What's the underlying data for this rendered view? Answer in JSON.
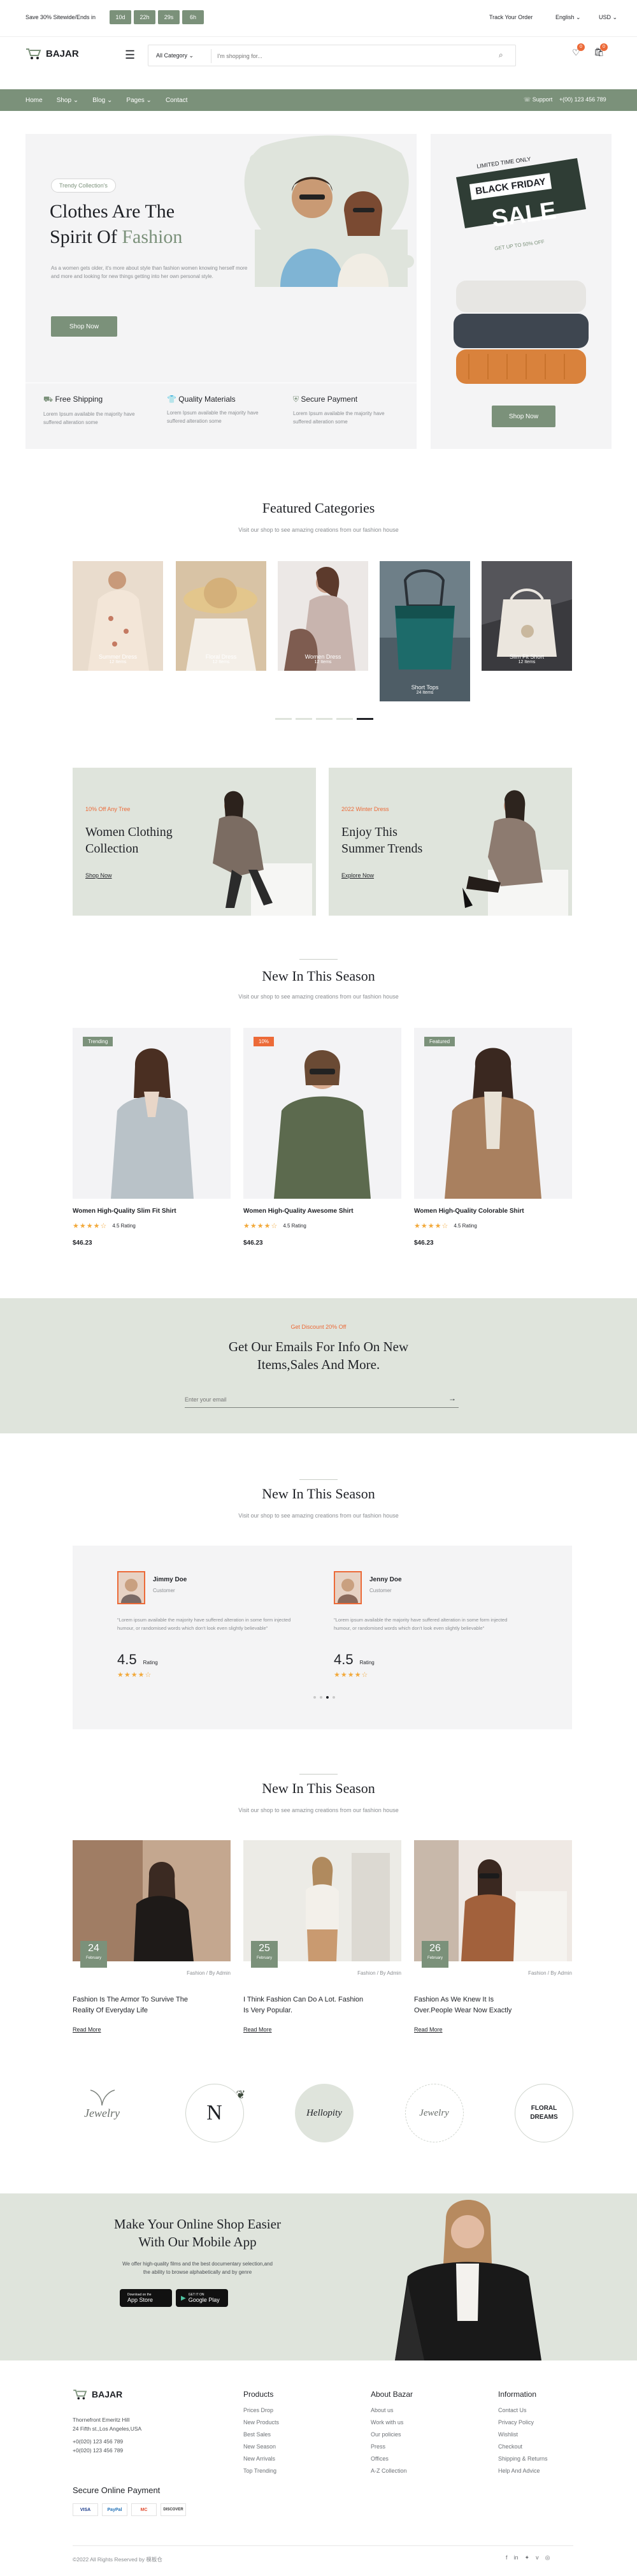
{
  "topbar": {
    "promo": "Save 30% Sitewide/Ends in",
    "countdown": [
      "10d",
      "22h",
      "29s",
      "6h"
    ],
    "track": "Track Your Order",
    "lang": "English",
    "currency": "USD"
  },
  "header": {
    "logo": "BAJAR",
    "category": "All Category",
    "search_placeholder": "I'm shopping for...",
    "cart_count": "0",
    "wish_count": "0"
  },
  "nav": {
    "items": [
      "Home",
      "Shop",
      "Blog",
      "Pages",
      "Contact"
    ],
    "support_label": "Support",
    "support_phone": "+(00) 123 456 789"
  },
  "hero": {
    "badge": "Trendy Collection's",
    "title_line1": "Clothes Are The",
    "title_line2_a": "Spirit Of ",
    "title_line2_b": "Fashion",
    "desc": "As a women gets older, it's more about style than fashion women knowing herself more and more and looking for new things getting into her own personal style.",
    "button": "Shop Now"
  },
  "sale": {
    "limited": "LIMITED TIME ONLY",
    "black_friday": "BLACK FRIDAY",
    "sale": "SALE",
    "off": "GET UP TO 50% OFF",
    "button": "Shop Now"
  },
  "features": [
    {
      "title": "Free Shipping",
      "desc": "Lorem Ipsum available the majority have suffered alteration some"
    },
    {
      "title": "Quality Materials",
      "desc": "Lorem Ipsum available the majority have suffered alteration some"
    },
    {
      "title": "Secure Payment",
      "desc": "Lorem Ipsum available the majority have suffered alteration some"
    }
  ],
  "featured": {
    "title": "Featured Categories",
    "subtitle": "Visit our shop to see amazing creations from our fashion house",
    "items": [
      {
        "name": "Summer Dress",
        "count": "12 Items"
      },
      {
        "name": "Floral Dress",
        "count": "12 Items"
      },
      {
        "name": "Women Dress",
        "count": "12 Items"
      },
      {
        "name": "Short Tops",
        "count": "24 Items"
      },
      {
        "name": "Slim Fit Short",
        "count": "12 Items"
      }
    ]
  },
  "promos": [
    {
      "tag": "10% Off Any Tree",
      "title1": "Women Clothing",
      "title2": "Collection",
      "link": "Shop Now"
    },
    {
      "tag": "2022 Winter Dress",
      "title1": "Enjoy This",
      "title2": "Summer Trends",
      "link": "Explore Now"
    }
  ],
  "newseason": {
    "title": "New In This Season",
    "subtitle": "Visit our shop to see amazing creations from our fashion house",
    "products": [
      {
        "badge": "Trending",
        "name": "Women High-Quality Slim Fit Shirt",
        "rating": "4.5 Rating",
        "price": "$46.23"
      },
      {
        "badge": "10%",
        "name": "Women High-Quality Awesome Shirt",
        "rating": "4.5 Rating",
        "price": "$46.23"
      },
      {
        "badge": "Featured",
        "name": "Women High-Quality Colorable Shirt",
        "rating": "4.5 Rating",
        "price": "$46.23"
      }
    ]
  },
  "newsletter": {
    "tag": "Get Discount 20% Off",
    "title1": "Get Our Emails For Info On New",
    "title2": "Items,Sales And More.",
    "placeholder": "Enter your email"
  },
  "testimonials": {
    "title": "New In This Season",
    "subtitle": "Visit our shop to see amazing creations from our fashion house",
    "items": [
      {
        "name": "Jimmy Doe",
        "role": "Customer",
        "text": "\"Lorem ipsum available the majority have suffered alteration in some form injected humour, or randomised words which don't look even slightly believable\"",
        "score": "4.5",
        "rating": "Rating"
      },
      {
        "name": "Jenny Doe",
        "role": "Customer",
        "text": "\"Lorem ipsum available the majority have suffered alteration in some form injected humour, or randomised words which don't look even slightly believable\"",
        "score": "4.5",
        "rating": "Rating"
      }
    ]
  },
  "blog": {
    "title": "New In This Season",
    "subtitle": "Visit our shop to see amazing creations from our fashion house",
    "posts": [
      {
        "day": "24",
        "month": "February",
        "meta": "Fashion / By Admin",
        "title1": "Fashion Is The Armor To Survive The",
        "title2": "Reality Of Everyday Life",
        "link": "Read More"
      },
      {
        "day": "25",
        "month": "February",
        "meta": "Fashion / By Admin",
        "title1": "I Think Fashion Can Do A Lot. Fashion",
        "title2": "Is Very Popular.",
        "link": "Read More"
      },
      {
        "day": "26",
        "month": "February",
        "meta": "Fashion / By Admin",
        "title1": "Fashion As We Knew It Is",
        "title2": "Over.People Wear Now Exactly",
        "link": "Read More"
      }
    ]
  },
  "brands": [
    "Jewelry",
    "N",
    "Hellopity",
    "Jewelry",
    "FLORAL DREAMS"
  ],
  "app": {
    "title1": "Make Your Online Shop Easier",
    "title2": "With Our Mobile App",
    "desc1": "We offer high-quality films and the best documentary selection,and",
    "desc2": "the ability to browse alphabetically and by genre",
    "appstore": "App Store",
    "appstore_small": "Download on the",
    "googleplay": "Google Play",
    "googleplay_small": "GET IT ON"
  },
  "footer": {
    "logo": "BAJAR",
    "addr1": "Thornefront Emeritz Hill",
    "addr2": "24 Fifth st.,Los Angeles,USA",
    "phone1": "+0(020) 123 456 789",
    "phone2": "+0(020) 123 456 789",
    "secure": "Secure Online Payment",
    "pay": [
      "VISA",
      "PayPal",
      "MC",
      "DISCOVER"
    ],
    "cols": [
      {
        "title": "Products",
        "links": [
          "Prices Drop",
          "New Products",
          "Best Sales",
          "New Season",
          "New Arrivals",
          "Top Trending"
        ]
      },
      {
        "title": "About Bazar",
        "links": [
          "About us",
          "Work with us",
          "Our policies",
          "Press",
          "Offices",
          "A-Z Collection"
        ]
      },
      {
        "title": "Information",
        "links": [
          "Contact Us",
          "Privacy Policy",
          "Wishlist",
          "Checkout",
          "Shipping & Returns",
          "Help And Advice"
        ]
      }
    ],
    "copyright": "©2022 All Rights Reserved by 模板仓"
  },
  "colors": {
    "accent": "#7b917a",
    "sage": "#dfe4dc",
    "orange": "#ec6a38",
    "dark": "#1f2126"
  }
}
